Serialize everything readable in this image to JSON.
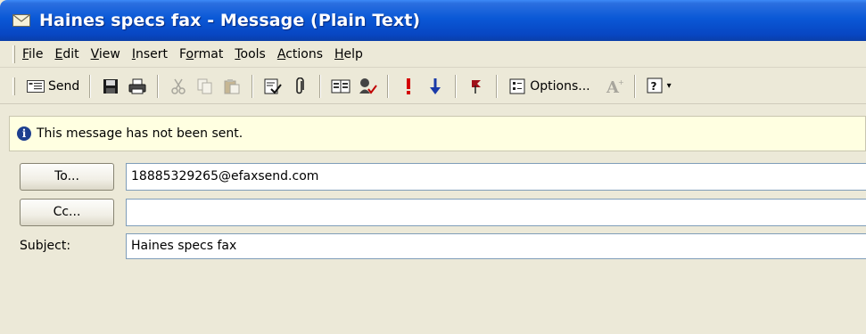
{
  "window": {
    "title": "Haines specs fax - Message (Plain Text)",
    "icon": "envelope-icon"
  },
  "menu": {
    "items": [
      {
        "label": "File",
        "accel": "F"
      },
      {
        "label": "Edit",
        "accel": "E"
      },
      {
        "label": "View",
        "accel": "V"
      },
      {
        "label": "Insert",
        "accel": "I"
      },
      {
        "label": "Format",
        "accel": "o"
      },
      {
        "label": "Tools",
        "accel": "T"
      },
      {
        "label": "Actions",
        "accel": "A"
      },
      {
        "label": "Help",
        "accel": "H"
      }
    ]
  },
  "toolbar": {
    "send_label": "Send",
    "options_label": "Options...",
    "icons": [
      "send-icon",
      "save-icon",
      "print-icon",
      "cut-icon",
      "copy-icon",
      "paste-icon",
      "check-names-icon",
      "attach-icon",
      "address-book-icon",
      "signature-icon",
      "high-importance-icon",
      "low-importance-icon",
      "follow-up-flag-icon",
      "options-icon",
      "font-icon",
      "help-icon"
    ]
  },
  "infobar": {
    "message": "This message has not been sent."
  },
  "header": {
    "to_button": "To...",
    "to_value": "18885329265@efaxsend.com",
    "cc_button": "Cc...",
    "cc_value": "",
    "subject_label": "Subject:",
    "subject_value": "Haines specs fax"
  },
  "colors": {
    "titlebar": "#0a58d6",
    "chrome": "#ece9d8",
    "infobar": "#ffffe1",
    "importance_high": "#d40000",
    "importance_low": "#1a3aa8"
  }
}
